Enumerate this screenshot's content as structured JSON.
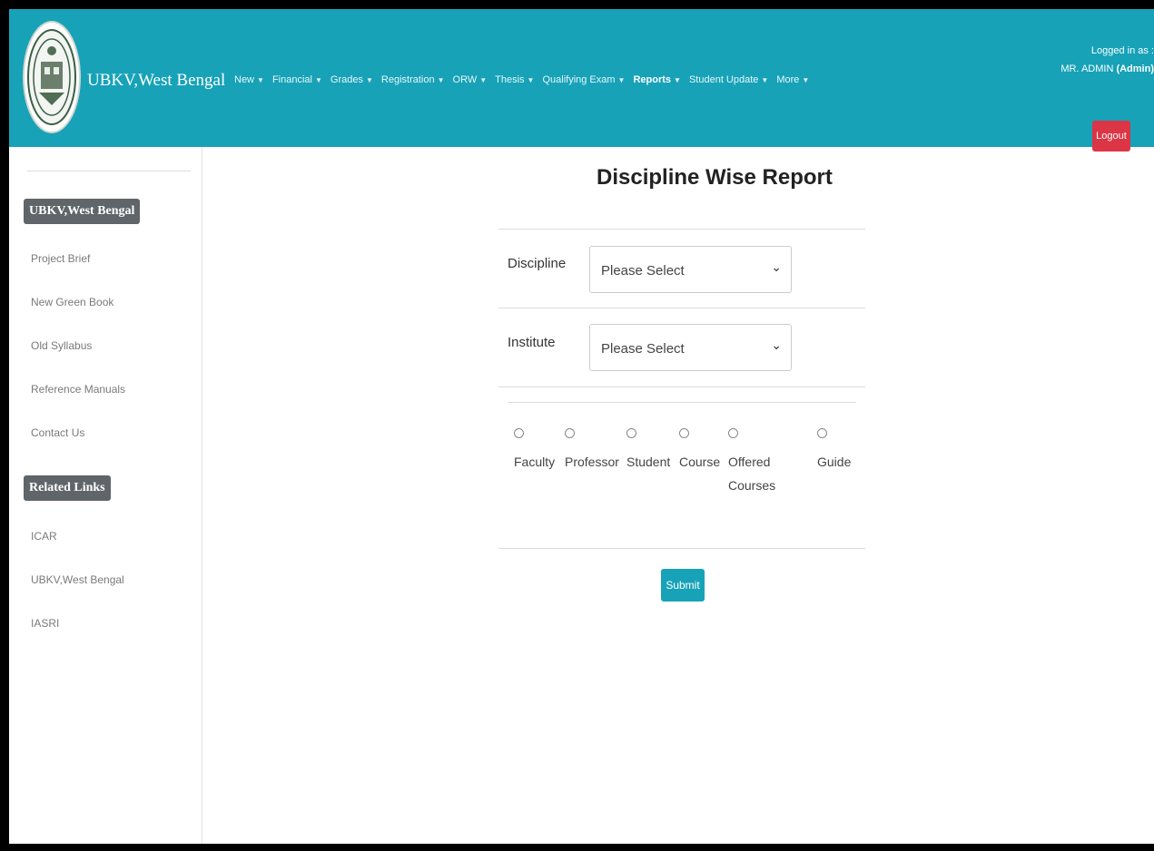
{
  "header": {
    "brand": "UBKV,West Bengal",
    "logo_icon": "university-emblem-icon",
    "nav": [
      {
        "label": "New",
        "active": false
      },
      {
        "label": "Financial",
        "active": false
      },
      {
        "label": "Grades",
        "active": false
      },
      {
        "label": "Registration",
        "active": false
      },
      {
        "label": "ORW",
        "active": false
      },
      {
        "label": "Thesis",
        "active": false
      },
      {
        "label": "Qualifying Exam",
        "active": false
      },
      {
        "label": "Reports",
        "active": true
      },
      {
        "label": "Student Update",
        "active": false
      },
      {
        "label": "More",
        "active": false
      }
    ],
    "login_text": "Logged in as :",
    "login_user": "MR. ADMIN",
    "login_role": "(Admin)",
    "logout_label": "Logout",
    "colors": {
      "header_bg": "#17a2b8",
      "logout_bg": "#dc3545"
    }
  },
  "sidebar": {
    "section1_title": "UBKV,West Bengal",
    "section1_links": [
      "Project Brief",
      "New Green Book",
      "Old Syllabus",
      "Reference Manuals",
      "Contact Us"
    ],
    "section2_title": "Related Links",
    "section2_links": [
      "ICAR",
      "UBKV,West Bengal",
      "IASRI"
    ]
  },
  "main": {
    "title": "Discipline Wise Report",
    "discipline_label": "Discipline",
    "discipline_value": "Please Select",
    "institute_label": "Institute",
    "institute_value": "Please Select",
    "report_options": [
      {
        "label": "Faculty",
        "selected": false
      },
      {
        "label": "Professor",
        "selected": false
      },
      {
        "label": "Student",
        "selected": false
      },
      {
        "label": "Course",
        "selected": false
      },
      {
        "label": "Offered Courses",
        "selected": false
      },
      {
        "label": "Guide",
        "selected": false
      }
    ],
    "submit_label": "Submit"
  }
}
